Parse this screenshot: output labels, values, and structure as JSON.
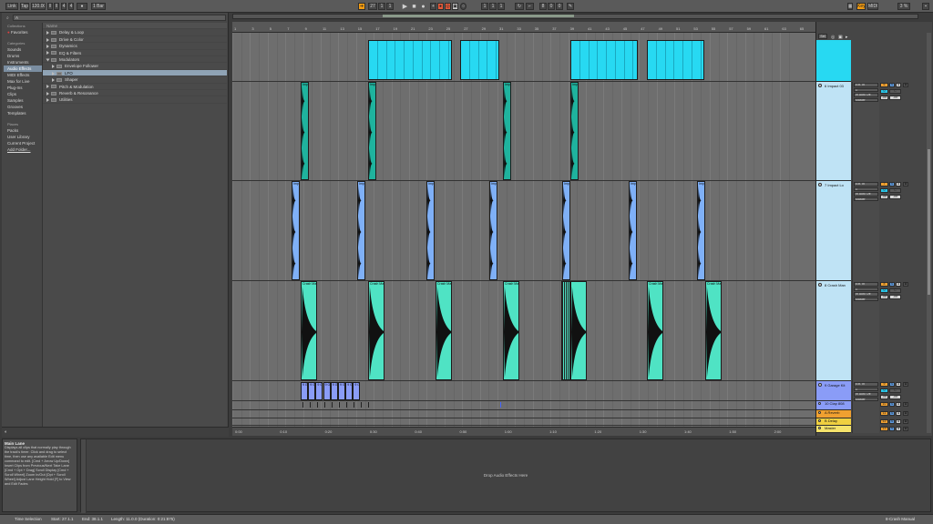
{
  "topbar": {
    "link": "Link",
    "tap": "Tap",
    "tempo": "120.00",
    "meter_num": "4",
    "meter_den": "4",
    "metro": "●",
    "quantize": "1 Bar",
    "pos": [
      "27",
      "1",
      "1"
    ],
    "loop_start": [
      "1",
      "1",
      "1"
    ],
    "loop_len": [
      "8",
      "0",
      "0"
    ],
    "key": "Key",
    "midi": "MIDI",
    "cpu": "3 %"
  },
  "browser": {
    "search_placeholder": "A",
    "places_header": "Collections",
    "favorites": "Favorites",
    "categories_header": "Categories",
    "categories": [
      "Sounds",
      "Drums",
      "Instruments",
      "Audio Effects",
      "MIDI Effects",
      "Max for Live",
      "Plug-Ins",
      "Clips",
      "Samples",
      "Grooves",
      "Templates"
    ],
    "places2_header": "Places",
    "places2": [
      "Packs",
      "User Library",
      "Current Project",
      "Add Folder..."
    ],
    "name_header": "Name",
    "items": [
      "Delay & Loop",
      "Drive & Color",
      "Dynamics",
      "EQ & Filters",
      "Modulators",
      "Envelope Follower",
      "LFO",
      "Shaper",
      "Pitch & Modulation",
      "Reverb & Resonance",
      "Utilities"
    ]
  },
  "ruler": {
    "bars": [
      "1",
      "3",
      "5",
      "7",
      "9",
      "11",
      "13",
      "15",
      "17",
      "19",
      "21",
      "23",
      "25",
      "27",
      "29",
      "31",
      "33",
      "35",
      "37",
      "39",
      "41",
      "43",
      "45",
      "47",
      "49",
      "51",
      "53",
      "55",
      "57",
      "59",
      "61",
      "63",
      "65"
    ],
    "times": [
      "0:00",
      "0:10",
      "0:20",
      "0:30",
      "0:40",
      "0:50",
      "1:00",
      "1:10",
      "1:20",
      "1:30",
      "1:40",
      "1:50",
      "2:00"
    ]
  },
  "tracks": [
    {
      "name": "6 Impact 03",
      "color": "#bfe3f5",
      "clip_color": "#1fb39e",
      "clip_name": "Imp"
    },
    {
      "name": "7 Impact Lo",
      "color": "#bfe3f5",
      "clip_color": "#7fb0f7",
      "clip_name": "Imp"
    },
    {
      "name": "8 Crash Man",
      "color": "#bfe3f5",
      "clip_color": "#4fe3c4",
      "clip_name": "Crash Ma"
    },
    {
      "name": "9 Garage Kit",
      "color": "#8a9cf7",
      "clip_color": "#8a9cf7",
      "clip_name": "9 G"
    },
    {
      "name": "10 Clap 808",
      "color": "#8a9cf7",
      "clip_color": "#8a9cf7",
      "clip_name": ""
    }
  ],
  "returns": [
    {
      "name": "A Reverb",
      "color": "#f0a030"
    },
    {
      "name": "B Delay",
      "color": "#f0d040"
    },
    {
      "name": "Master",
      "color": "#f5e36b"
    }
  ],
  "mixer": {
    "input": "Ext. In",
    "ch": "1",
    "monitor": [
      "In",
      "Auto",
      "Off"
    ],
    "output": "Master",
    "vol": "0",
    "pan": "C",
    "sends": [
      "-inf",
      "-inf"
    ]
  },
  "info": {
    "title": "Main Lane",
    "body": "Displays all clips that normally play through the track's timer. Click and drag to select time, then use any available Edit menu command to edit. [Cmd + Arrow Up/Down] Insert Clips from Previous/Next Take Lane [Cmd + Opt + Drag] Scroll Display [Cmd + Scroll Wheel] Zoom In/Out [Opt + Scroll Wheel] Adjust Lane Height Hold [F] to View and Edit Fades"
  },
  "device": {
    "drop": "Drop Audio Effects Here"
  },
  "status": {
    "left": "Time Selection",
    "start": "Start: 27.1.1",
    "end": "End: 38.1.1",
    "length": "Length: 11.0.0  (Duration: 0:21:875)",
    "right": "8-Crash Manual"
  },
  "colors": {
    "accent": "#f39c12",
    "cyan": "#27d9f2",
    "selected": "#7a8da0"
  }
}
